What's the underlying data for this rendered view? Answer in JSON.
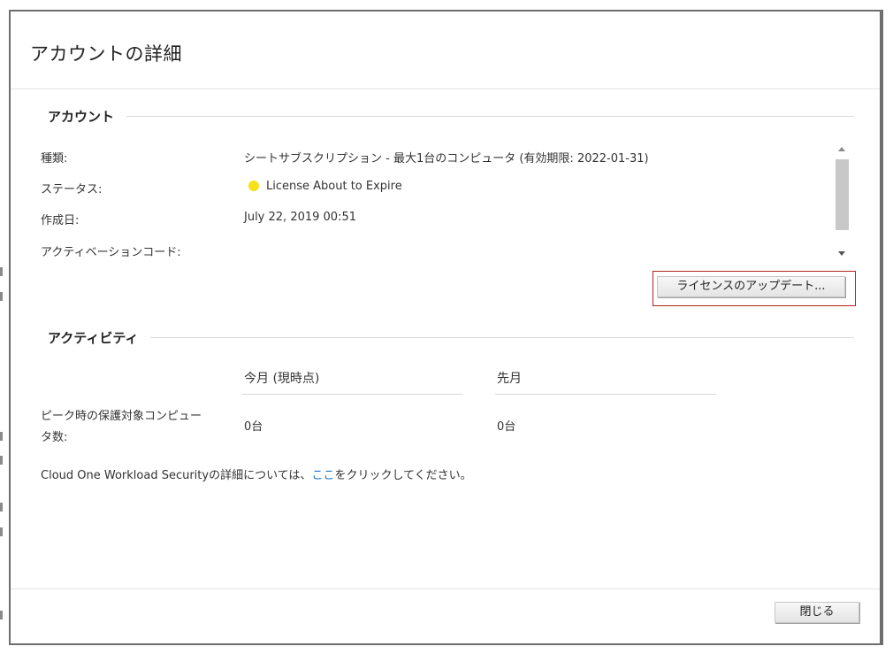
{
  "dialog": {
    "title": "アカウントの詳細"
  },
  "account": {
    "section_label": "アカウント",
    "rows": [
      {
        "label": "種類:",
        "value": "シートサブスクリプション - 最大1台のコンピュータ (有効期限: 2022-01-31)"
      },
      {
        "label": "ステータス:",
        "value": "License About to Expire"
      },
      {
        "label": "作成日:",
        "value": "July 22, 2019 00:51"
      },
      {
        "label": "アクティベーションコード:",
        "value": ""
      }
    ],
    "status_color": "#f6e21a",
    "update_button": "ライセンスのアップデート..."
  },
  "activity": {
    "section_label": "アクティビティ",
    "columns": [
      "今月 (現時点)",
      "先月"
    ],
    "row_label_line1": "ピーク時の保護対象コンピュー",
    "row_label_line2": "タ数:",
    "values": [
      "0台",
      "0台"
    ],
    "info_prefix": "Cloud One Workload Securityの詳細については、",
    "info_link": "ここ",
    "info_suffix": "をクリックしてください。"
  },
  "footer": {
    "close_button": "閉じる"
  },
  "colors": {
    "highlight_border": "#b22222",
    "link": "#1a73c8"
  }
}
